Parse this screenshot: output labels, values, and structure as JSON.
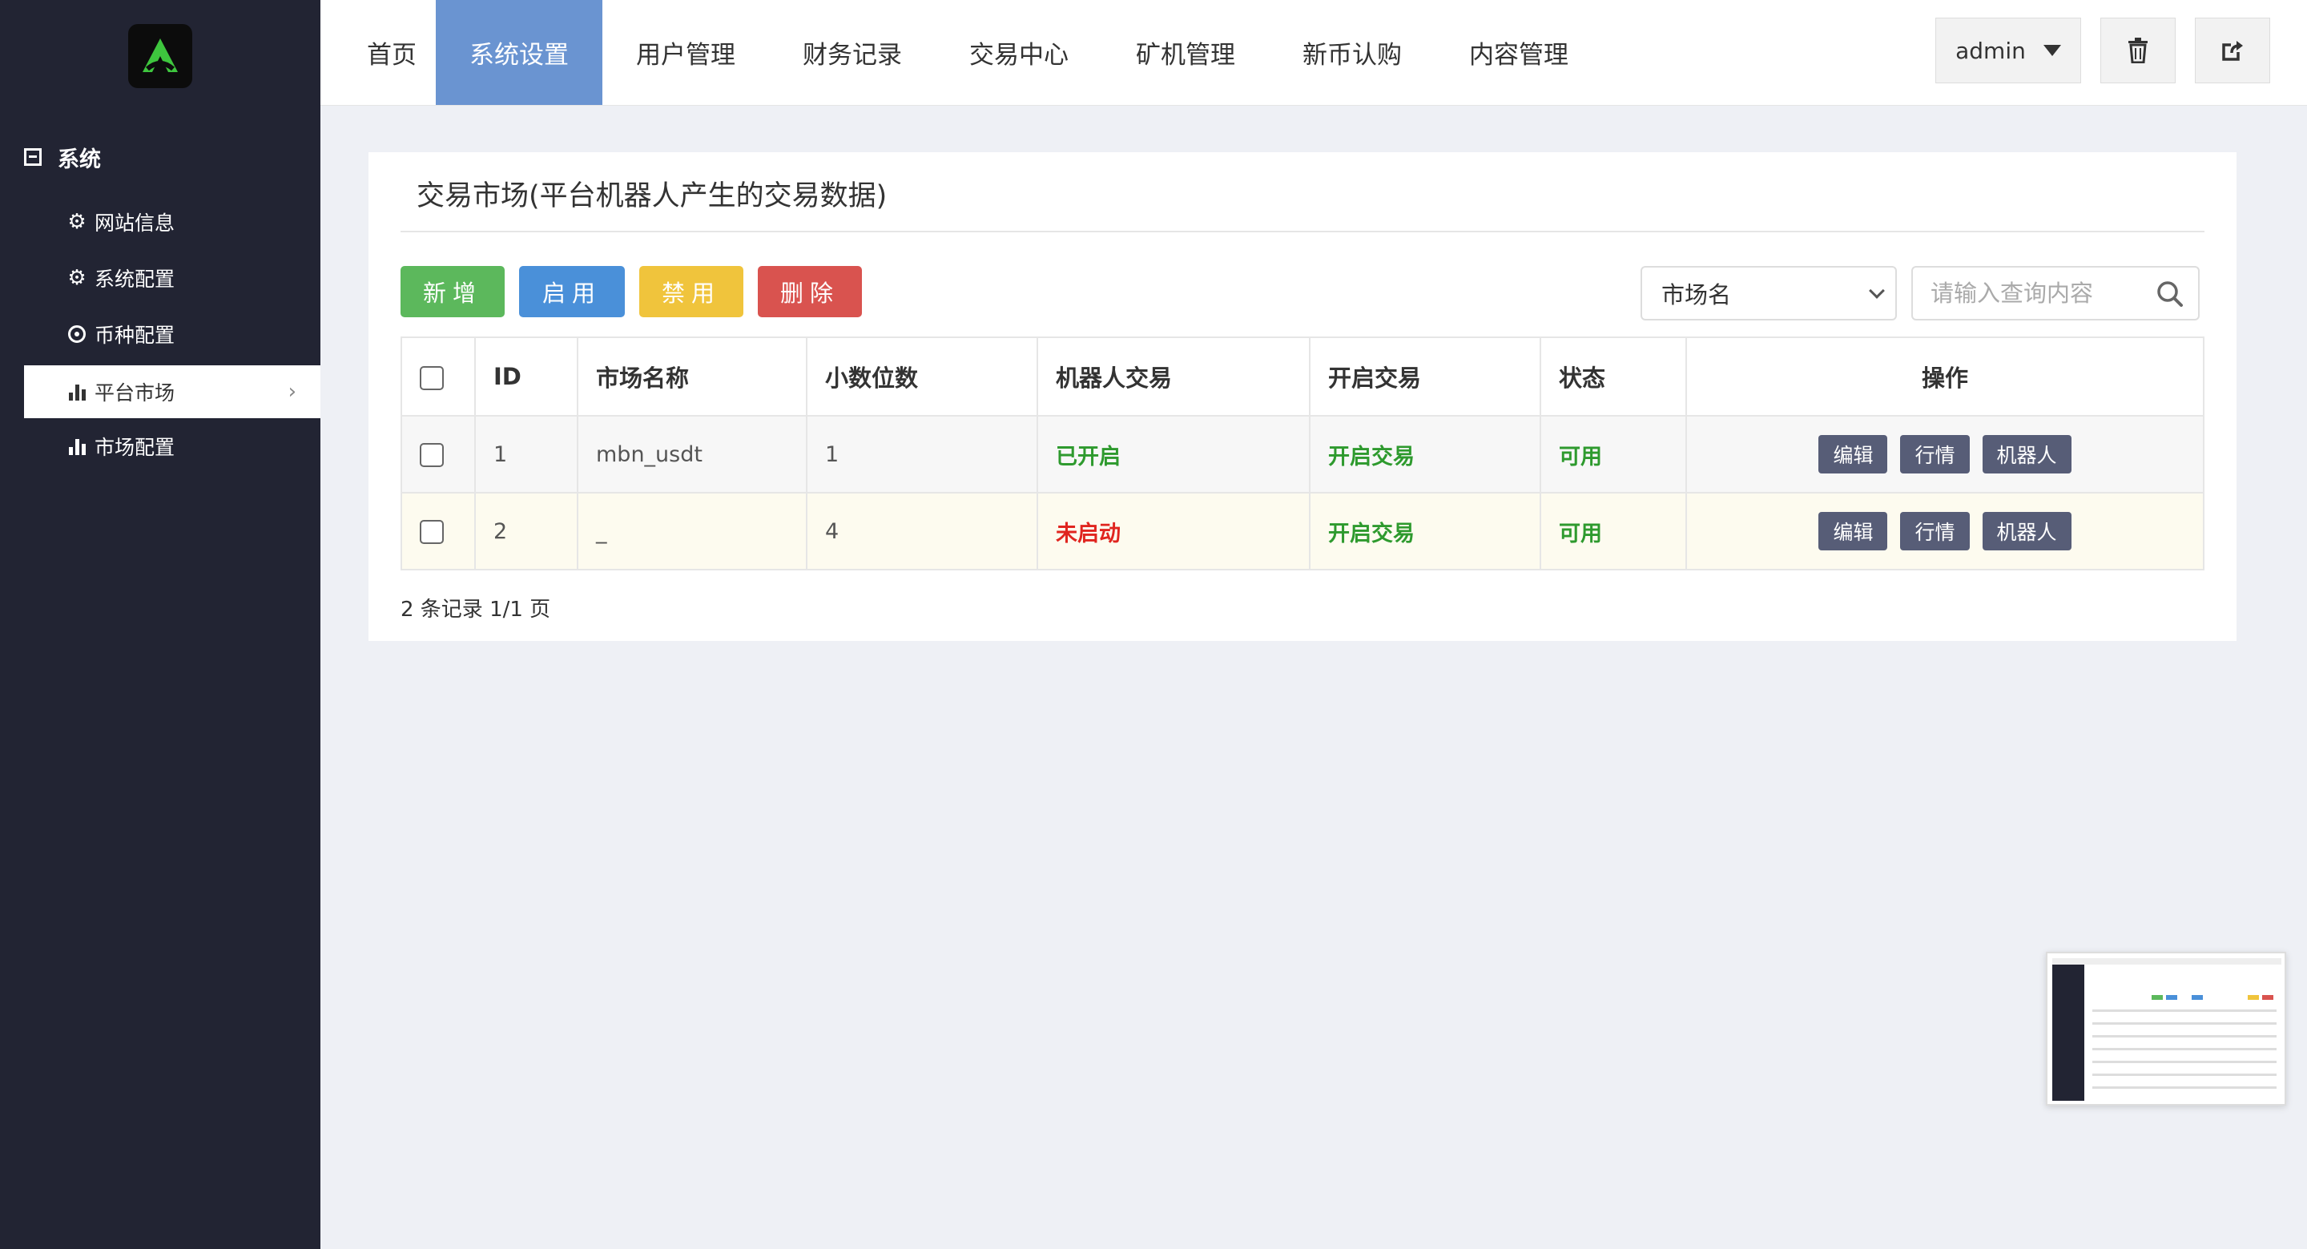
{
  "sidebar": {
    "group_label": "系统",
    "items": [
      {
        "label": "网站信息",
        "icon": "gear-icon"
      },
      {
        "label": "系统配置",
        "icon": "gear-icon"
      },
      {
        "label": "币种配置",
        "icon": "dot-circle-icon"
      },
      {
        "label": "平台市场",
        "icon": "bar-chart-icon",
        "active": true
      },
      {
        "label": "市场配置",
        "icon": "bar-chart-icon"
      }
    ]
  },
  "nav": {
    "items": [
      "首页",
      "系统设置",
      "用户管理",
      "财务记录",
      "交易中心",
      "矿机管理",
      "新币认购",
      "内容管理"
    ],
    "active_index": 1,
    "user_label": "admin"
  },
  "panel": {
    "title": "交易市场(平台机器人产生的交易数据)",
    "buttons": {
      "add": "新增",
      "enable": "启用",
      "disable": "禁用",
      "delete": "删除"
    },
    "filter_select": "市场名",
    "search_placeholder": "请输入查询内容",
    "columns": [
      "ID",
      "市场名称",
      "小数位数",
      "机器人交易",
      "开启交易",
      "状态",
      "操作"
    ],
    "rows": [
      {
        "id": "1",
        "name": "mbn_usdt",
        "decimals": "1",
        "robot": "已开启",
        "trade": "开启交易",
        "status": "可用"
      },
      {
        "id": "2",
        "name": "_",
        "decimals": "4",
        "robot": "未启动",
        "trade": "开启交易",
        "status": "可用"
      }
    ],
    "actions": [
      "编辑",
      "行情",
      "机器人"
    ],
    "footer": "2 条记录 1/1 页"
  },
  "colors": {
    "sidebar_bg": "#222433",
    "nav_active": "#6a94d1",
    "btn_add": "#5cb85c",
    "btn_enable": "#4a90d9",
    "btn_disable": "#f0c43c",
    "btn_delete": "#d9534f",
    "enabled_text": "#2e9a2e",
    "disabled_text": "#e0251f"
  }
}
